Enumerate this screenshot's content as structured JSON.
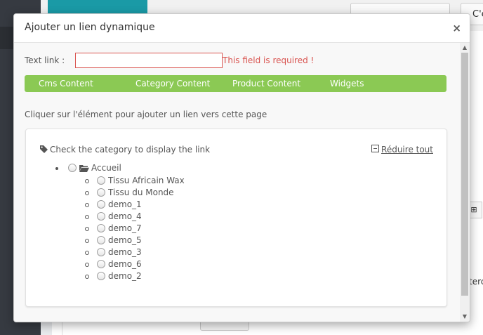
{
  "background": {
    "right_button_text": "C'e",
    "editor_fragment": "terc"
  },
  "modal": {
    "title": "Ajouter un lien dynamique",
    "close_glyph": "×",
    "text_link": {
      "label": "Text link :",
      "value": "",
      "error": "This field is required !"
    },
    "tabs": [
      {
        "label": "Cms Content"
      },
      {
        "label": "Category Content"
      },
      {
        "label": "Product Content"
      },
      {
        "label": "Widgets"
      }
    ],
    "instruction": "Cliquer sur l'élément pour ajouter un lien vers cette page",
    "tree": {
      "header": "Check the category to display the link",
      "collapse_label": "Réduire tout",
      "root": {
        "label": "Accueil",
        "icon": "folder-open-icon"
      },
      "children": [
        {
          "label": "Tissu Africain Wax"
        },
        {
          "label": "Tissu du Monde"
        },
        {
          "label": "demo_1"
        },
        {
          "label": "demo_4"
        },
        {
          "label": "demo_7"
        },
        {
          "label": "demo_5"
        },
        {
          "label": "demo_3"
        },
        {
          "label": "demo_6"
        },
        {
          "label": "demo_2"
        }
      ]
    }
  },
  "colors": {
    "tab_bar": "#8bc954",
    "error": "#d9534f",
    "sidebar": "#363a41",
    "accent_teal": "#1a9aa6"
  }
}
